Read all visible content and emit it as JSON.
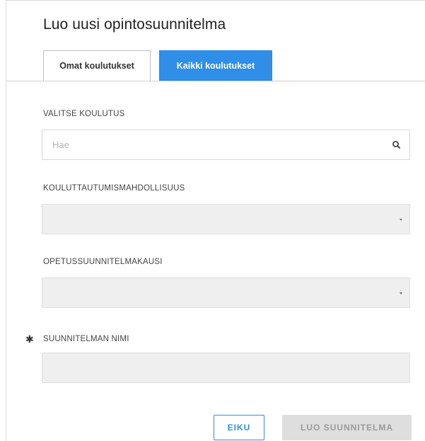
{
  "dialog": {
    "title": "Luo uusi opintosuunnitelma"
  },
  "tabs": [
    {
      "label": "Omat koulutukset",
      "active": false
    },
    {
      "label": "Kaikki koulutukset",
      "active": true
    }
  ],
  "fields": {
    "education": {
      "label": "VALITSE KOULUTUS",
      "placeholder": "Hae",
      "icon": "search-icon"
    },
    "opportunity": {
      "label": "KOULUTTAUTUMISMAHDOLLISUUS",
      "value": "",
      "icon": "caret-down-icon"
    },
    "curriculum_period": {
      "label": "OPETUSSUUNNITELMAKAUSI",
      "value": "",
      "icon": "caret-down-icon"
    },
    "plan_name": {
      "required_marker": "✱",
      "label": "SUUNNITELMAN NIMI",
      "value": ""
    }
  },
  "buttons": {
    "cancel": "EIKU",
    "create": "LUO SUUNNITELMA"
  },
  "colors": {
    "accent": "#2f8ee8",
    "disabled_bg": "#dedede",
    "field_bg": "#efefef"
  }
}
